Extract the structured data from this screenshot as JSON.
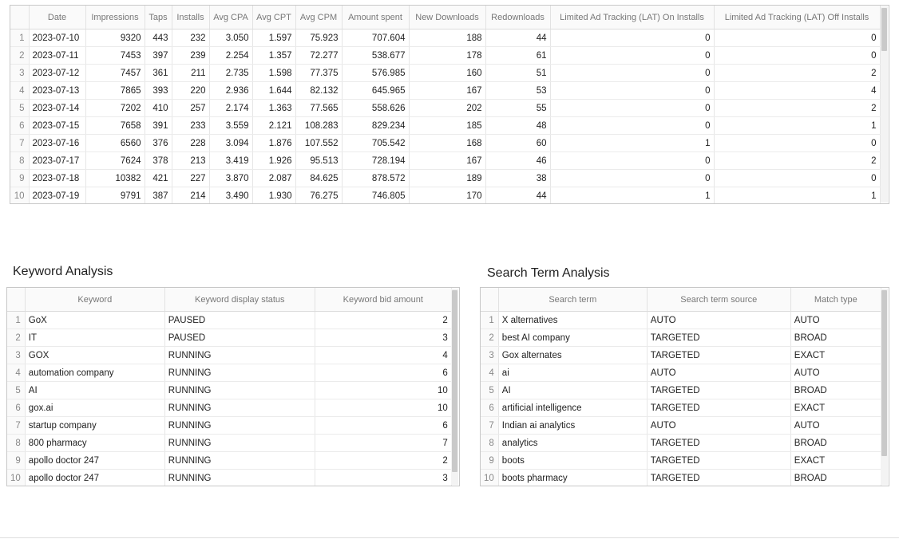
{
  "campaign_table": {
    "columns": [
      "",
      "Date",
      "Impressions",
      "Taps",
      "Installs",
      "Avg CPA",
      "Avg CPT",
      "Avg CPM",
      "Amount spent",
      "New Downloads",
      "Redownloads",
      "Limited Ad Tracking (LAT) On Installs",
      "Limited Ad Tracking (LAT) Off Installs"
    ],
    "rows": [
      [
        "1",
        "2023-07-10",
        "9320",
        "443",
        "232",
        "3.050",
        "1.597",
        "75.923",
        "707.604",
        "188",
        "44",
        "0",
        "0"
      ],
      [
        "2",
        "2023-07-11",
        "7453",
        "397",
        "239",
        "2.254",
        "1.357",
        "72.277",
        "538.677",
        "178",
        "61",
        "0",
        "0"
      ],
      [
        "3",
        "2023-07-12",
        "7457",
        "361",
        "211",
        "2.735",
        "1.598",
        "77.375",
        "576.985",
        "160",
        "51",
        "0",
        "2"
      ],
      [
        "4",
        "2023-07-13",
        "7865",
        "393",
        "220",
        "2.936",
        "1.644",
        "82.132",
        "645.965",
        "167",
        "53",
        "0",
        "4"
      ],
      [
        "5",
        "2023-07-14",
        "7202",
        "410",
        "257",
        "2.174",
        "1.363",
        "77.565",
        "558.626",
        "202",
        "55",
        "0",
        "2"
      ],
      [
        "6",
        "2023-07-15",
        "7658",
        "391",
        "233",
        "3.559",
        "2.121",
        "108.283",
        "829.234",
        "185",
        "48",
        "0",
        "1"
      ],
      [
        "7",
        "2023-07-16",
        "6560",
        "376",
        "228",
        "3.094",
        "1.876",
        "107.552",
        "705.542",
        "168",
        "60",
        "1",
        "0"
      ],
      [
        "8",
        "2023-07-17",
        "7624",
        "378",
        "213",
        "3.419",
        "1.926",
        "95.513",
        "728.194",
        "167",
        "46",
        "0",
        "2"
      ],
      [
        "9",
        "2023-07-18",
        "10382",
        "421",
        "227",
        "3.870",
        "2.087",
        "84.625",
        "878.572",
        "189",
        "38",
        "0",
        "0"
      ],
      [
        "10",
        "2023-07-19",
        "9791",
        "387",
        "214",
        "3.490",
        "1.930",
        "76.275",
        "746.805",
        "170",
        "44",
        "1",
        "1"
      ]
    ]
  },
  "keyword_section": {
    "title": "Keyword Analysis",
    "columns": [
      "",
      "Keyword",
      "Keyword display status",
      "Keyword bid amount"
    ],
    "rows": [
      [
        "1",
        "GoX",
        "PAUSED",
        "2"
      ],
      [
        "2",
        "IT",
        "PAUSED",
        "3"
      ],
      [
        "3",
        "GOX",
        "RUNNING",
        "4"
      ],
      [
        "4",
        "automation company",
        "RUNNING",
        "6"
      ],
      [
        "5",
        "AI",
        "RUNNING",
        "10"
      ],
      [
        "6",
        "gox.ai",
        "RUNNING",
        "10"
      ],
      [
        "7",
        "startup company",
        "RUNNING",
        "6"
      ],
      [
        "8",
        "800 pharmacy",
        "RUNNING",
        "7"
      ],
      [
        "9",
        "apollo doctor 247",
        "RUNNING",
        "2"
      ],
      [
        "10",
        "apollo doctor 247",
        "RUNNING",
        "3"
      ]
    ]
  },
  "search_term_section": {
    "title": "Search Term Analysis",
    "columns": [
      "",
      "Search term",
      "Search term source",
      "Match type"
    ],
    "rows": [
      [
        "1",
        "X alternatives",
        "AUTO",
        "AUTO"
      ],
      [
        "2",
        "best AI company",
        "TARGETED",
        "BROAD"
      ],
      [
        "3",
        "Gox alternates",
        "TARGETED",
        "EXACT"
      ],
      [
        "4",
        "ai",
        "AUTO",
        "AUTO"
      ],
      [
        "5",
        "AI",
        "TARGETED",
        "BROAD"
      ],
      [
        "6",
        "artificial intelligence",
        "TARGETED",
        "EXACT"
      ],
      [
        "7",
        "Indian ai analytics",
        "AUTO",
        "AUTO"
      ],
      [
        "8",
        "analytics",
        "TARGETED",
        "BROAD"
      ],
      [
        "9",
        "boots",
        "TARGETED",
        "EXACT"
      ],
      [
        "10",
        "boots pharmacy",
        "TARGETED",
        "BROAD"
      ]
    ]
  }
}
